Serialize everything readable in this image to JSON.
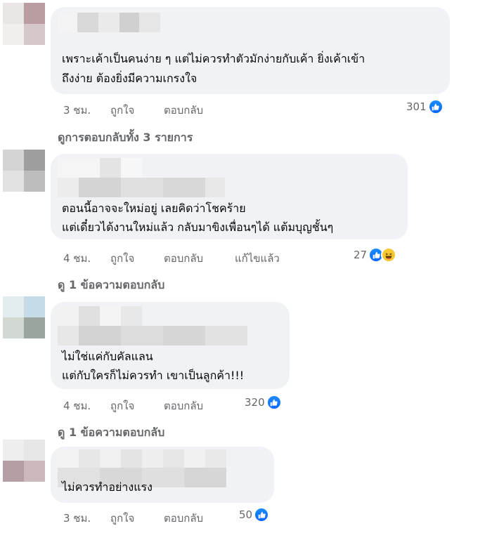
{
  "comments": [
    {
      "text_lines": [
        "เพราะเค้าเป็นคนง่าย ๆ แต่ไม่ควรทำตัวมักง่ายกับเค้า ยิ่งเค้าเข้า",
        "ถึงง่าย ต้องยิ่งมีความเกรงใจ"
      ],
      "time": "3 ชม.",
      "like_label": "ถูกใจ",
      "reply_label": "ตอบกลับ",
      "edited_label": "",
      "reaction_count": "301",
      "reactions": [
        "like-icon"
      ],
      "view_replies": "ดูการตอบกลับทั้ง 3 รายการ"
    },
    {
      "text_lines": [
        "ตอนนี้อาจจะใหม่อยู่ เลยคิดว่าโชคร้าย",
        "แต่เดี๋ยวได้งานใหม่แล้ว กลับมาขิงเพื่อนๆได้ แต้มบุญชั้นๆ"
      ],
      "time": "4 ชม.",
      "like_label": "ถูกใจ",
      "reply_label": "ตอบกลับ",
      "edited_label": "แก้ไขแล้ว",
      "reaction_count": "27",
      "reactions": [
        "like-icon",
        "haha-icon"
      ],
      "view_replies": "ดู 1 ข้อความตอบกลับ"
    },
    {
      "text_lines": [
        "ไม่ใช่แค่กับคัลแลน",
        "แต่กับใครก็ไม่ควรทำ เขาเป็นลูกค้า!!!"
      ],
      "time": "4 ชม.",
      "like_label": "ถูกใจ",
      "reply_label": "ตอบกลับ",
      "edited_label": "",
      "reaction_count": "320",
      "reactions": [
        "like-icon"
      ],
      "view_replies": "ดู 1 ข้อความตอบกลับ"
    },
    {
      "text_lines": [
        "ไม่ควรทำอย่างแรง"
      ],
      "time": "3 ชม.",
      "like_label": "ถูกใจ",
      "reply_label": "ตอบกลับ",
      "edited_label": "",
      "reaction_count": "50",
      "reactions": [
        "like-icon"
      ],
      "view_replies": ""
    }
  ],
  "colors": {
    "bubble": "#f0f2f5",
    "meta": "#65676b",
    "like_blue": "#0866ff",
    "haha_yellow": "#f7c633"
  }
}
